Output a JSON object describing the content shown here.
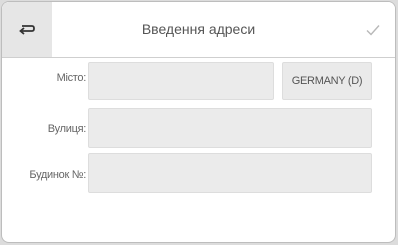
{
  "header": {
    "title": "Введення адреси",
    "back_icon": "return-arrow-icon",
    "confirm_icon": "checkmark-icon"
  },
  "form": {
    "city_label": "Місто:",
    "city_value": "",
    "country_label": "GERMANY (D)",
    "street_label": "Вулиця:",
    "street_value": "",
    "house_label": "Будинок №:",
    "house_value": ""
  },
  "colors": {
    "background": "#ffffff",
    "field_fill": "#ebebeb",
    "text": "#555555"
  }
}
